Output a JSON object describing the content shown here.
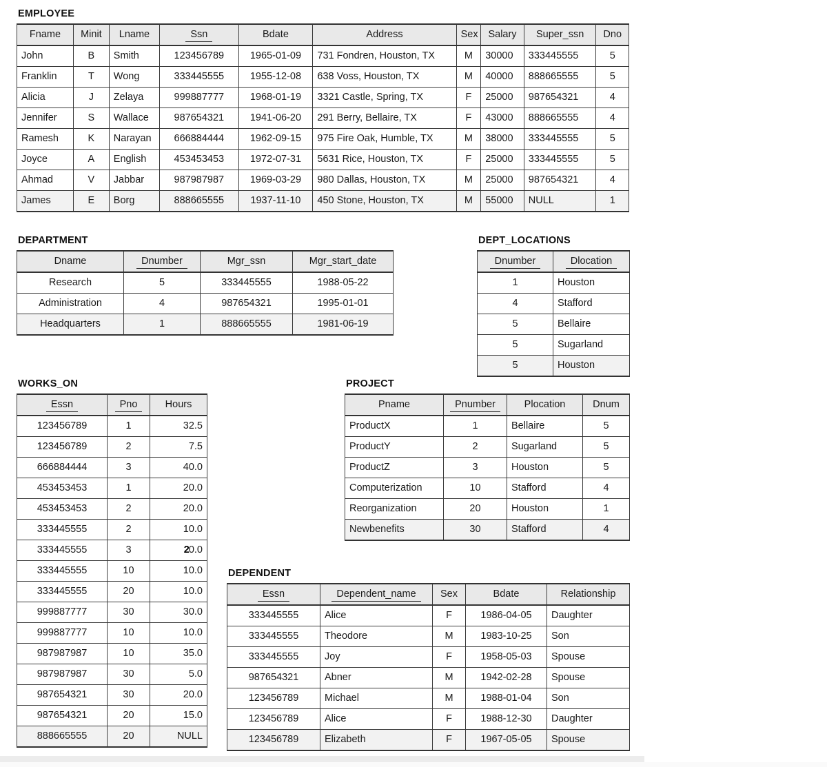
{
  "tables": [
    {
      "id": "employee",
      "title": "EMPLOYEE",
      "columns": [
        {
          "label": "Fname",
          "pk": false,
          "align": "l"
        },
        {
          "label": "Minit",
          "pk": false,
          "align": "c"
        },
        {
          "label": "Lname",
          "pk": false,
          "align": "l"
        },
        {
          "label": "Ssn",
          "pk": true,
          "align": "c"
        },
        {
          "label": "Bdate",
          "pk": false,
          "align": "c"
        },
        {
          "label": "Address",
          "pk": false,
          "align": "l"
        },
        {
          "label": "Sex",
          "pk": false,
          "align": "c"
        },
        {
          "label": "Salary",
          "pk": false,
          "align": "l"
        },
        {
          "label": "Super_ssn",
          "pk": false,
          "align": "l"
        },
        {
          "label": "Dno",
          "pk": false,
          "align": "c"
        }
      ],
      "rows": [
        [
          "John",
          "B",
          "Smith",
          "123456789",
          "1965-01-09",
          "731 Fondren, Houston, TX",
          "M",
          "30000",
          "333445555",
          "5"
        ],
        [
          "Franklin",
          "T",
          "Wong",
          "333445555",
          "1955-12-08",
          "638 Voss, Houston, TX",
          "M",
          "40000",
          "888665555",
          "5"
        ],
        [
          "Alicia",
          "J",
          "Zelaya",
          "999887777",
          "1968-01-19",
          "3321 Castle, Spring, TX",
          "F",
          "25000",
          "987654321",
          "4"
        ],
        [
          "Jennifer",
          "S",
          "Wallace",
          "987654321",
          "1941-06-20",
          "291 Berry, Bellaire, TX",
          "F",
          "43000",
          "888665555",
          "4"
        ],
        [
          "Ramesh",
          "K",
          "Narayan",
          "666884444",
          "1962-09-15",
          "975 Fire Oak, Humble, TX",
          "M",
          "38000",
          "333445555",
          "5"
        ],
        [
          "Joyce",
          "A",
          "English",
          "453453453",
          "1972-07-31",
          "5631 Rice, Houston, TX",
          "F",
          "25000",
          "333445555",
          "5"
        ],
        [
          "Ahmad",
          "V",
          "Jabbar",
          "987987987",
          "1969-03-29",
          "980 Dallas, Houston, TX",
          "M",
          "25000",
          "987654321",
          "4"
        ],
        [
          "James",
          "E",
          "Borg",
          "888665555",
          "1937-11-10",
          "450 Stone, Houston, TX",
          "M",
          "55000",
          "NULL",
          "1"
        ]
      ]
    },
    {
      "id": "department",
      "title": "DEPARTMENT",
      "columns": [
        {
          "label": "Dname",
          "pk": false,
          "align": "c"
        },
        {
          "label": "Dnumber",
          "pk": true,
          "align": "c"
        },
        {
          "label": "Mgr_ssn",
          "pk": false,
          "align": "c"
        },
        {
          "label": "Mgr_start_date",
          "pk": false,
          "align": "c"
        }
      ],
      "rows": [
        [
          "Research",
          "5",
          "333445555",
          "1988-05-22"
        ],
        [
          "Administration",
          "4",
          "987654321",
          "1995-01-01"
        ],
        [
          "Headquarters",
          "1",
          "888665555",
          "1981-06-19"
        ]
      ]
    },
    {
      "id": "dept_locations",
      "title": "DEPT_LOCATIONS",
      "columns": [
        {
          "label": "Dnumber",
          "pk": true,
          "align": "c"
        },
        {
          "label": "Dlocation",
          "pk": true,
          "align": "l"
        }
      ],
      "rows": [
        [
          "1",
          "Houston"
        ],
        [
          "4",
          "Stafford"
        ],
        [
          "5",
          "Bellaire"
        ],
        [
          "5",
          "Sugarland"
        ],
        [
          "5",
          "Houston"
        ]
      ]
    },
    {
      "id": "works_on",
      "title": "WORKS_ON",
      "columns": [
        {
          "label": "Essn",
          "pk": true,
          "align": "c"
        },
        {
          "label": "Pno",
          "pk": true,
          "align": "c"
        },
        {
          "label": "Hours",
          "pk": false,
          "align": "r"
        }
      ],
      "rows": [
        [
          "123456789",
          "1",
          "32.5"
        ],
        [
          "123456789",
          "2",
          "7.5"
        ],
        [
          "666884444",
          "3",
          "40.0"
        ],
        [
          "453453453",
          "1",
          "20.0"
        ],
        [
          "453453453",
          "2",
          "20.0"
        ],
        [
          "333445555",
          "2",
          "10.0"
        ],
        [
          "333445555",
          "3",
          "20.0"
        ],
        [
          "333445555",
          "10",
          "10.0"
        ],
        [
          "333445555",
          "20",
          "10.0"
        ],
        [
          "999887777",
          "30",
          "30.0"
        ],
        [
          "999887777",
          "10",
          "10.0"
        ],
        [
          "987987987",
          "10",
          "35.0"
        ],
        [
          "987987987",
          "30",
          "5.0"
        ],
        [
          "987654321",
          "30",
          "20.0"
        ],
        [
          "987654321",
          "20",
          "15.0"
        ],
        [
          "888665555",
          "20",
          "NULL"
        ]
      ],
      "annotated_cell": {
        "row": 6,
        "col": 2,
        "mark": "2"
      }
    },
    {
      "id": "project",
      "title": "PROJECT",
      "columns": [
        {
          "label": "Pname",
          "pk": false,
          "align": "l"
        },
        {
          "label": "Pnumber",
          "pk": true,
          "align": "c"
        },
        {
          "label": "Plocation",
          "pk": false,
          "align": "l"
        },
        {
          "label": "Dnum",
          "pk": false,
          "align": "c"
        }
      ],
      "rows": [
        [
          "ProductX",
          "1",
          "Bellaire",
          "5"
        ],
        [
          "ProductY",
          "2",
          "Sugarland",
          "5"
        ],
        [
          "ProductZ",
          "3",
          "Houston",
          "5"
        ],
        [
          "Computerization",
          "10",
          "Stafford",
          "4"
        ],
        [
          "Reorganization",
          "20",
          "Houston",
          "1"
        ],
        [
          "Newbenefits",
          "30",
          "Stafford",
          "4"
        ]
      ]
    },
    {
      "id": "dependent",
      "title": "DEPENDENT",
      "columns": [
        {
          "label": "Essn",
          "pk": true,
          "align": "c"
        },
        {
          "label": "Dependent_name",
          "pk": true,
          "align": "l"
        },
        {
          "label": "Sex",
          "pk": false,
          "align": "c"
        },
        {
          "label": "Bdate",
          "pk": false,
          "align": "c"
        },
        {
          "label": "Relationship",
          "pk": false,
          "align": "l"
        }
      ],
      "rows": [
        [
          "333445555",
          "Alice",
          "F",
          "1986-04-05",
          "Daughter"
        ],
        [
          "333445555",
          "Theodore",
          "M",
          "1983-10-25",
          "Son"
        ],
        [
          "333445555",
          "Joy",
          "F",
          "1958-05-03",
          "Spouse"
        ],
        [
          "987654321",
          "Abner",
          "M",
          "1942-02-28",
          "Spouse"
        ],
        [
          "123456789",
          "Michael",
          "M",
          "1988-01-04",
          "Son"
        ],
        [
          "123456789",
          "Alice",
          "F",
          "1988-12-30",
          "Daughter"
        ],
        [
          "123456789",
          "Elizabeth",
          "F",
          "1967-05-05",
          "Spouse"
        ]
      ]
    }
  ]
}
